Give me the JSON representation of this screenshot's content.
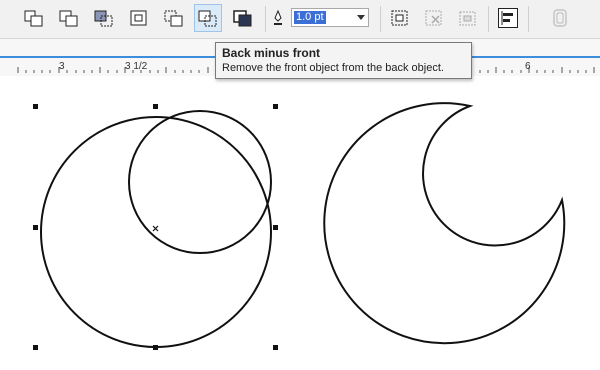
{
  "toolbar": {
    "tools": [
      {
        "name": "weld-icon"
      },
      {
        "name": "trim-icon"
      },
      {
        "name": "intersect-icon"
      },
      {
        "name": "simplify-icon"
      },
      {
        "name": "front-minus-back-icon"
      },
      {
        "name": "back-minus-front-icon"
      },
      {
        "name": "create-boundary-icon"
      },
      {
        "name": "pen-outline-icon"
      },
      {
        "name": "combine-icon"
      },
      {
        "name": "break-apart-icon"
      },
      {
        "name": "group-icon"
      },
      {
        "name": "align-distribute-icon"
      },
      {
        "name": "lock-object-icon"
      }
    ],
    "outline_width": "1.0 pt"
  },
  "ruler": {
    "labels": [
      "3",
      "3 1/2",
      "6"
    ]
  },
  "tooltip": {
    "title": "Back minus front",
    "description": "Remove the front object from the back object."
  }
}
